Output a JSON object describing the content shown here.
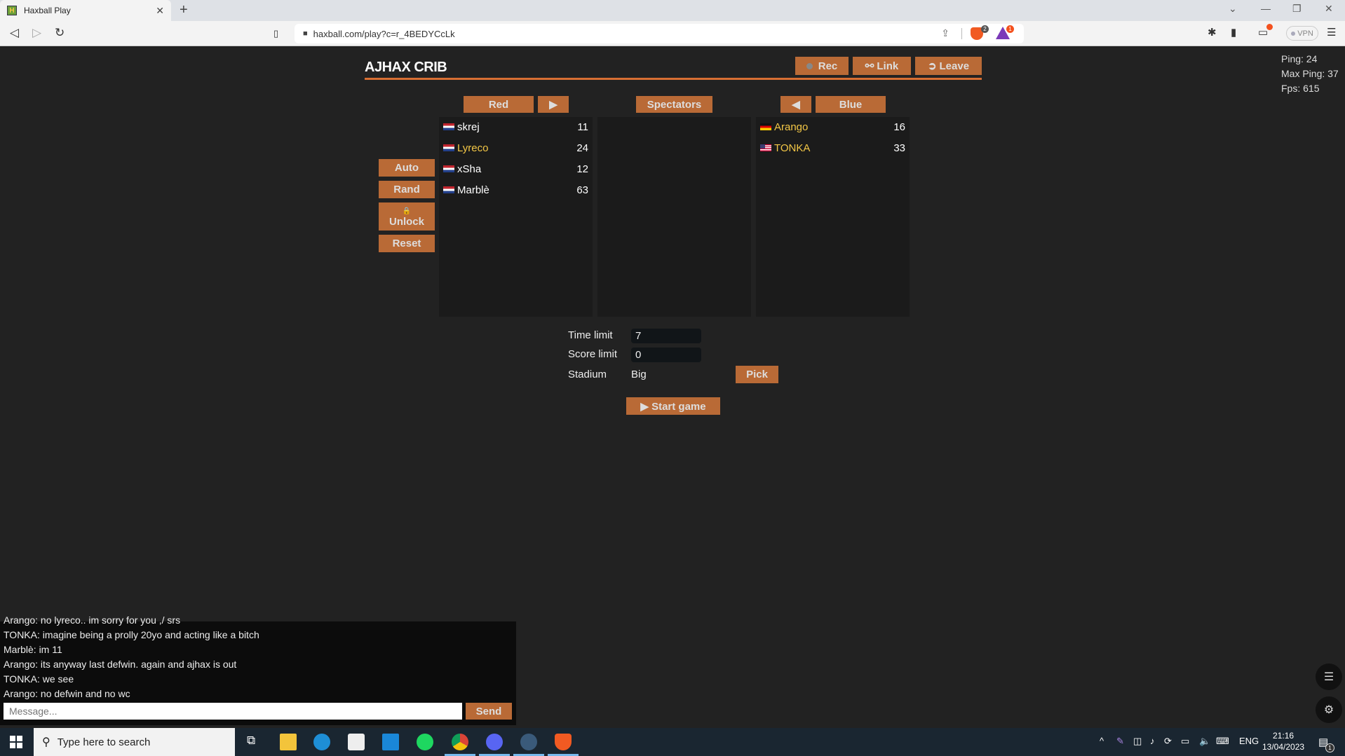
{
  "browser": {
    "tab_title": "Haxball Play",
    "tab_favicon_letter": "H",
    "url": "haxball.com/play?c=r_4BEDYCcLk",
    "brave_shield_count": "2",
    "rewards_count": "1",
    "vpn_label": "VPN",
    "icons": {
      "back": "◁",
      "forward": "▷",
      "reload": "↻",
      "bookmark": "🔖",
      "lock": "🔒",
      "share": "⇪",
      "extensions": "✱",
      "sidebar": "▮",
      "wallet": "▭",
      "menu": "☰",
      "close": "✕",
      "newtab": "+",
      "minimize": "—",
      "restore": "❐",
      "win_close": "✕",
      "tabs_dropdown": "⌄"
    }
  },
  "stats": {
    "ping": "Ping: 24",
    "max_ping": "Max Ping: 37",
    "fps": "Fps: 615"
  },
  "room": {
    "title": "AJHAX CRIB",
    "buttons": {
      "rec": "Rec",
      "link": "Link",
      "leave": "Leave",
      "link_icon": "⚯",
      "leave_icon": "➲"
    },
    "admin_buttons": {
      "auto": "Auto",
      "rand": "Rand",
      "unlock": "Unlock",
      "unlock_icon": "🔒",
      "reset": "Reset"
    },
    "teams": {
      "red_label": "Red",
      "red_move_icon": "▶",
      "spectators_label": "Spectators",
      "blue_move_icon": "◀",
      "blue_label": "Blue"
    },
    "red_players": [
      {
        "name": "skrej",
        "ping": "11",
        "flag": "nl",
        "admin": false
      },
      {
        "name": "Lyreco",
        "ping": "24",
        "flag": "nl",
        "admin": true
      },
      {
        "name": "xSha",
        "ping": "12",
        "flag": "nl",
        "admin": false
      },
      {
        "name": "Marblè",
        "ping": "63",
        "flag": "nl",
        "admin": false
      }
    ],
    "spectators": [],
    "blue_players": [
      {
        "name": "Arango",
        "ping": "16",
        "flag": "de",
        "admin": true
      },
      {
        "name": "TONKA",
        "ping": "33",
        "flag": "us",
        "admin": true
      }
    ],
    "settings": {
      "time_limit_label": "Time limit",
      "time_limit_value": "7",
      "score_limit_label": "Score limit",
      "score_limit_value": "0",
      "stadium_label": "Stadium",
      "stadium_value": "Big",
      "pick_label": "Pick",
      "start_label": "▶ Start game"
    }
  },
  "chat": {
    "messages": [
      "Arango: no lyreco.. im sorry for you ,/ srs",
      "TONKA: imagine being a prolly 20yo and acting like a bitch",
      "Marblè: im 11",
      "Arango: its anyway last defwin. again and ajhax is out",
      "TONKA: we see",
      "Arango: no defwin and no wc"
    ],
    "input_placeholder": "Message...",
    "send_label": "Send"
  },
  "floating": {
    "menu_icon": "☰",
    "settings_icon": "⚙"
  },
  "taskbar": {
    "search_placeholder": "Type here to search",
    "language": "ENG",
    "time": "21:16",
    "date": "13/04/2023",
    "notification_count": "1",
    "apps": [
      "task-view",
      "file-explorer",
      "edge",
      "store",
      "mail",
      "spotify",
      "chrome",
      "discord",
      "app-circle",
      "brave"
    ]
  }
}
